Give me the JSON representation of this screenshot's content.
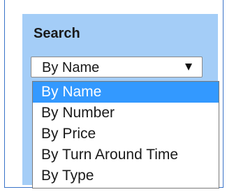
{
  "search_panel": {
    "title": "Search",
    "select": {
      "value": "By Name",
      "arrow_icon": "caret-down-icon"
    },
    "options": [
      {
        "label": "By Name",
        "selected": true
      },
      {
        "label": "By Number",
        "selected": false
      },
      {
        "label": "By Price",
        "selected": false
      },
      {
        "label": "By Turn Around Time",
        "selected": false
      },
      {
        "label": "By Type",
        "selected": false
      }
    ]
  },
  "colors": {
    "panel_background": "#a4cdf7",
    "border": "#3a73c8",
    "highlight": "#3399ff"
  }
}
